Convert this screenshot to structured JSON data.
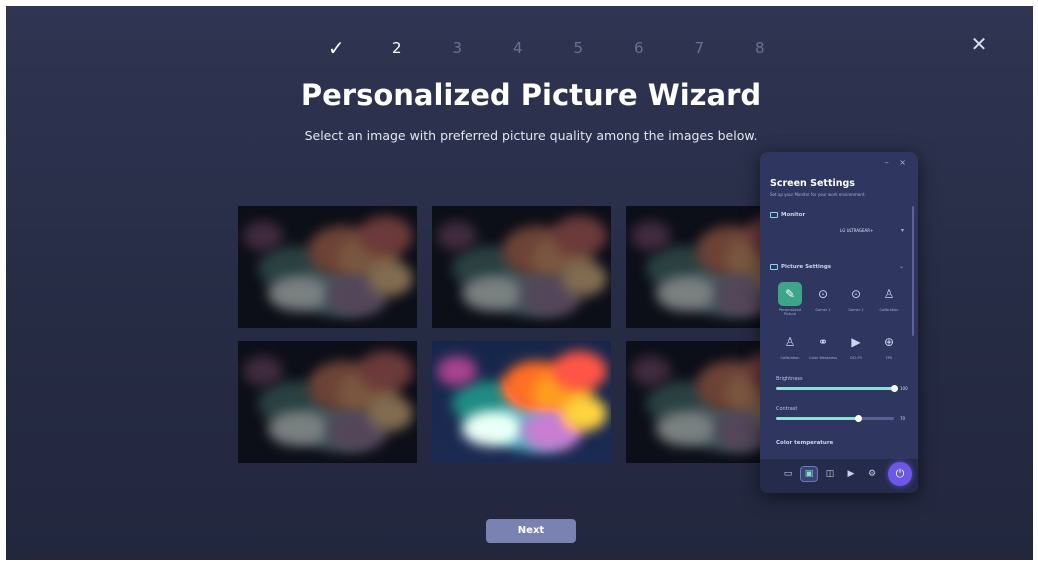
{
  "wizard": {
    "steps": [
      {
        "label": "✓",
        "state": "done"
      },
      {
        "label": "2",
        "state": "current"
      },
      {
        "label": "3",
        "state": "upcoming"
      },
      {
        "label": "4",
        "state": "upcoming"
      },
      {
        "label": "5",
        "state": "upcoming"
      },
      {
        "label": "6",
        "state": "upcoming"
      },
      {
        "label": "7",
        "state": "upcoming"
      },
      {
        "label": "8",
        "state": "upcoming"
      }
    ],
    "close_icon": "close-icon",
    "title": "Personalized Picture Wizard",
    "subtitle": "Select an image with preferred picture quality among the images below.",
    "images": [
      {
        "name": "option-1",
        "style": "dim"
      },
      {
        "name": "option-2",
        "style": "dim"
      },
      {
        "name": "option-3",
        "style": "dim"
      },
      {
        "name": "option-4",
        "style": "dim"
      },
      {
        "name": "option-5",
        "style": "bright"
      },
      {
        "name": "option-6",
        "style": "dim"
      }
    ],
    "next_label": "Next"
  },
  "screen_settings": {
    "window_buttons": "– ×",
    "title": "Screen Settings",
    "subtitle": "Set up your Monitor for your work environment.",
    "monitor_heading": "Monitor",
    "monitor_value": "LG ULTRAGEAR+",
    "picture_heading": "Picture Settings",
    "picture_modes": [
      {
        "label": "Personalized Picture",
        "icon": "palette-icon",
        "active": true
      },
      {
        "label": "Gamer 1",
        "icon": "gamepad-icon",
        "active": false
      },
      {
        "label": "Gamer 2",
        "icon": "gamepad-icon",
        "active": false
      },
      {
        "label": "Calibration",
        "icon": "calibrate-icon",
        "active": false
      },
      {
        "label": "Calibration",
        "icon": "calibrate-icon",
        "active": false
      },
      {
        "label": "Color Weakness",
        "icon": "color-weakness-icon",
        "active": false
      },
      {
        "label": "DCI-P3",
        "icon": "play-icon",
        "active": false
      },
      {
        "label": "FPS",
        "icon": "crosshair-icon",
        "active": false
      }
    ],
    "brightness_label": "Brightness",
    "brightness_value": "100",
    "brightness_fraction": 1.0,
    "contrast_label": "Contrast",
    "contrast_value": "70",
    "contrast_fraction": 0.7,
    "color_temp_label": "Color temperature",
    "toolbar": [
      "monitor-settings-icon",
      "picture-icon",
      "split-screen-icon",
      "input-icon",
      "gear-icon"
    ],
    "fab_icon": "power-icon",
    "accent": "#6b58e6"
  }
}
